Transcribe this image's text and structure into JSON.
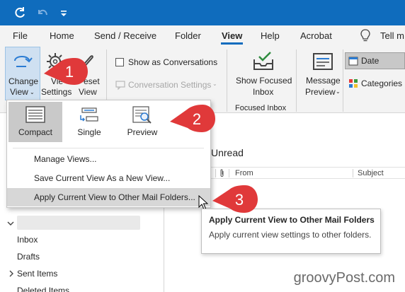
{
  "titlebar": {
    "bg_color": "#0f6cbd"
  },
  "tabs": [
    {
      "label": "File",
      "active": false
    },
    {
      "label": "Home",
      "active": false
    },
    {
      "label": "Send / Receive",
      "active": false
    },
    {
      "label": "Folder",
      "active": false
    },
    {
      "label": "View",
      "active": true
    },
    {
      "label": "Help",
      "active": false
    },
    {
      "label": "Acrobat",
      "active": false
    },
    {
      "label": "Tell m",
      "active": false
    }
  ],
  "ribbon": {
    "change_view_line1": "Change",
    "change_view_line2": "View",
    "view_settings_line1": "Vie",
    "view_settings_line2": "Settings",
    "reset_view_line1": "eset",
    "reset_view_line2": "View",
    "show_as_conversations": "Show as Conversations",
    "conversation_settings": "Conversation Settings",
    "show_focused_inbox_line1": "Show Focused",
    "show_focused_inbox_line2": "Inbox",
    "focused_inbox_group": "Focused Inbox",
    "message_preview_line1": "Message",
    "message_preview_line2": "Preview",
    "arrangement_date": "Date",
    "arrangement_categories": "Categories"
  },
  "dropdown": {
    "options": [
      {
        "label": "Compact",
        "selected": true
      },
      {
        "label": "Single",
        "selected": false
      },
      {
        "label": "Preview",
        "selected": false
      }
    ],
    "items": [
      {
        "label": "Manage Views...",
        "hover": false
      },
      {
        "label": "Save Current View As a New View...",
        "hover": false
      },
      {
        "label": "Apply Current View to Other Mail Folders...",
        "hover": true
      }
    ]
  },
  "message_list": {
    "unread": "Unread",
    "col_from": "From",
    "col_subject": "Subject"
  },
  "folders": {
    "inbox": "Inbox",
    "drafts": "Drafts",
    "sent_items": "Sent Items",
    "deleted_items": "Deleted Items"
  },
  "tooltip": {
    "title": "Apply Current View to Other Mail Folders",
    "description": "Apply current view settings to other folders."
  },
  "callouts": [
    "1",
    "2",
    "3"
  ],
  "watermark": "groovyPost.com",
  "colors": {
    "accent": "#0f6cbd",
    "callout_red": "#e0393a"
  }
}
